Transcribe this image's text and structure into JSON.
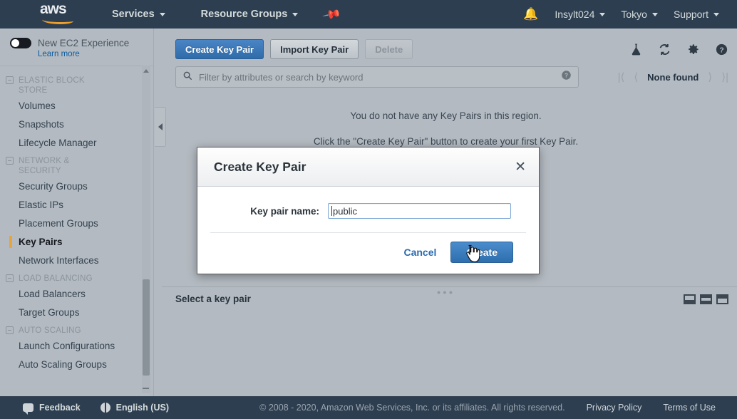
{
  "topnav": {
    "logo_text": "aws",
    "services_label": "Services",
    "resource_groups_label": "Resource Groups",
    "pin_icon": "pushpin-icon",
    "bell_icon": "notification-bell-icon",
    "account_label": "Insylt024",
    "region_label": "Tokyo",
    "support_label": "Support",
    "background_color": "#2d3e50"
  },
  "sidebar": {
    "new_experience_label": "New EC2 Experience",
    "learn_more_label": "Learn more",
    "toggle_state": "off",
    "groups": [
      {
        "title": "ELASTIC BLOCK STORE",
        "items": [
          {
            "label": "Volumes",
            "selected": false
          },
          {
            "label": "Snapshots",
            "selected": false
          },
          {
            "label": "Lifecycle Manager",
            "selected": false
          }
        ]
      },
      {
        "title": "NETWORK & SECURITY",
        "items": [
          {
            "label": "Security Groups",
            "selected": false
          },
          {
            "label": "Elastic IPs",
            "selected": false
          },
          {
            "label": "Placement Groups",
            "selected": false
          },
          {
            "label": "Key Pairs",
            "selected": true
          },
          {
            "label": "Network Interfaces",
            "selected": false
          }
        ]
      },
      {
        "title": "LOAD BALANCING",
        "items": [
          {
            "label": "Load Balancers",
            "selected": false
          },
          {
            "label": "Target Groups",
            "selected": false
          }
        ]
      },
      {
        "title": "AUTO SCALING",
        "items": [
          {
            "label": "Launch Configurations",
            "selected": false
          },
          {
            "label": "Auto Scaling Groups",
            "selected": false
          }
        ]
      }
    ],
    "accent_color": "#e8a33d"
  },
  "toolbar": {
    "create_label": "Create Key Pair",
    "import_label": "Import Key Pair",
    "delete_label": "Delete",
    "delete_disabled": true,
    "icons": [
      "beta-flask-icon",
      "refresh-icon",
      "gear-icon",
      "help-icon"
    ]
  },
  "filter": {
    "placeholder": "Filter by attributes or search by keyword",
    "search_icon": "search-icon",
    "help_icon": "help-circle-icon"
  },
  "pager": {
    "first_icon": "page-first-icon",
    "prev_icon": "page-prev-icon",
    "status": "None found",
    "next_icon": "page-next-icon",
    "last_icon": "page-last-icon"
  },
  "empty_state": {
    "line1": "You do not have any Key Pairs in this region.",
    "line2": "Click the \"Create Key Pair\" button to create your first Key Pair."
  },
  "detail_panel": {
    "title": "Select a key pair",
    "view_toggles": [
      "layout-bottom-icon",
      "layout-split-icon",
      "layout-top-icon"
    ]
  },
  "modal": {
    "title": "Create Key Pair",
    "close_icon": "close-icon",
    "field_label": "Key pair name:",
    "field_value": "public",
    "cancel_label": "Cancel",
    "create_label": "Create",
    "cursor": "hand-pointer-cursor"
  },
  "footer": {
    "feedback_label": "Feedback",
    "language_label": "English (US)",
    "copyright": "© 2008 - 2020, Amazon Web Services, Inc. or its affiliates. All rights reserved.",
    "privacy_label": "Privacy Policy",
    "terms_label": "Terms of Use"
  }
}
